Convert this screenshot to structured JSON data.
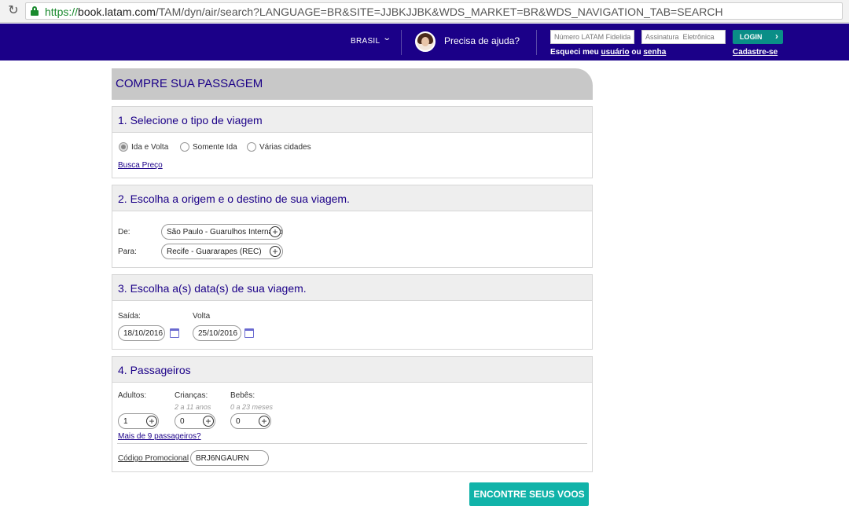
{
  "browser": {
    "url_scheme": "https://",
    "url_host": "book.latam.com",
    "url_path": "/TAM/dyn/air/search?LANGUAGE=BR&SITE=JJBKJJBK&WDS_MARKET=BR&WDS_NAVIGATION_TAB=SEARCH"
  },
  "header": {
    "country": "BRASIL",
    "help_text": "Precisa de ajuda?",
    "loyalty_placeholder": "Número LATAM Fidelidade",
    "signature_placeholder": "Assinatura  Eletrônica",
    "login_label": "LOGIN",
    "forgot_prefix": "Esqueci meu ",
    "forgot_user": "usuário",
    "forgot_or": " ou ",
    "forgot_password": "senha",
    "signup": "Cadastre-se"
  },
  "page": {
    "title": "COMPRE SUA PASSAGEM"
  },
  "section1": {
    "title": "1. Selecione o tipo de viagem",
    "options": [
      "Ida e Volta",
      "Somente Ida",
      "Várias cidades"
    ],
    "selected": "Ida e Volta",
    "price_search": "Busca Preço"
  },
  "section2": {
    "title": "2. Escolha a origem e o destino de sua viagem.",
    "from_label": "De:",
    "from_value": "São Paulo - Guarulhos Internacional",
    "to_label": "Para:",
    "to_value": "Recife - Guararapes (REC)"
  },
  "section3": {
    "title": "3. Escolha a(s) data(s) de sua viagem.",
    "departure_label": "Saída:",
    "departure_value": "18/10/2016",
    "return_label": "Volta",
    "return_value": "25/10/2016"
  },
  "section4": {
    "title": "4. Passageiros",
    "adults_label": "Adultos:",
    "adults_value": "1",
    "children_label": "Crianças:",
    "children_hint": "2 a 11 anos",
    "children_value": "0",
    "babies_label": "Bebês:",
    "babies_hint": "0 a 23 meses",
    "babies_value": "0",
    "more_passengers": "Mais de 9 passageiros?",
    "promo_label": "Código Promocional",
    "promo_value": "BRJ6NGAURN"
  },
  "actions": {
    "find_flights": "ENCONTRE SEUS VOOS"
  },
  "colors": {
    "brand": "#1b0088",
    "accent": "#11b3a9"
  }
}
